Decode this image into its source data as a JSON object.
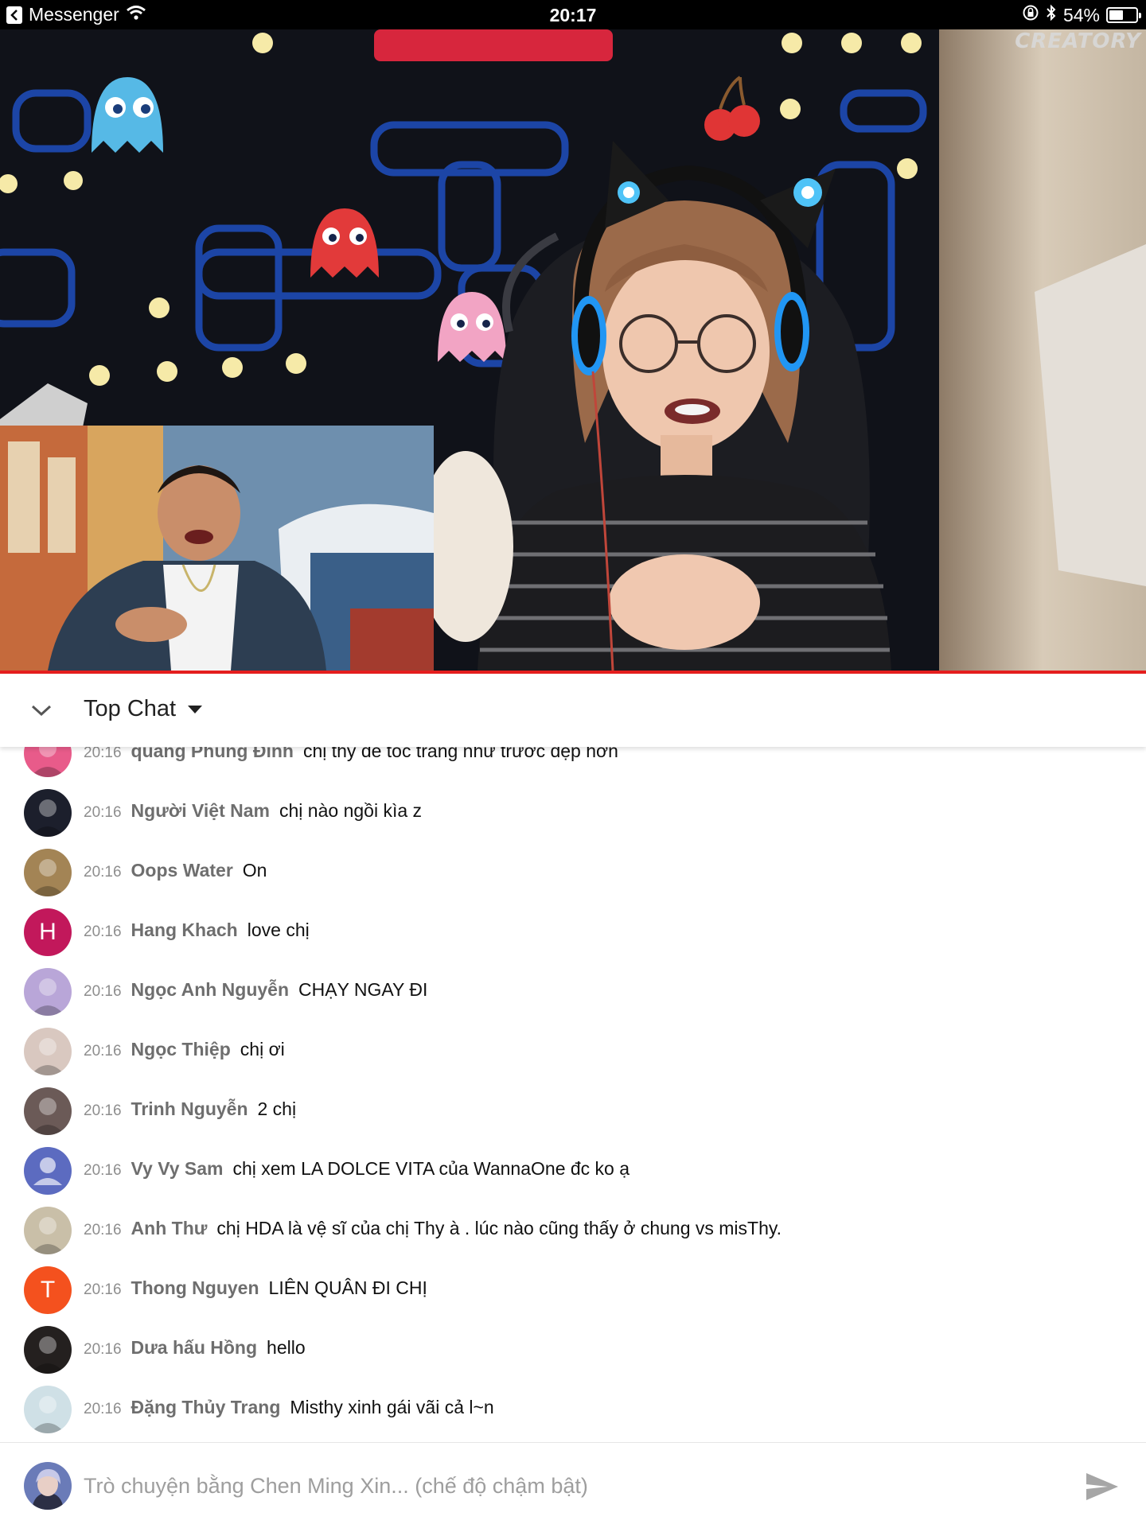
{
  "status_bar": {
    "back_app": "Messenger",
    "time": "20:17",
    "battery": "54%",
    "battery_level": 0.54
  },
  "video": {
    "watermark": "CREATORY",
    "progress": 1.0,
    "progress_color": "#e51e1e"
  },
  "chat_header": {
    "title": "Top Chat"
  },
  "messages": [
    {
      "time": "20:16",
      "author": "quang Phùng Đình",
      "text": "chị thy để tóc trăng như trước đẹp hơn",
      "avatar_color": "#e85b8a",
      "avatar_letter": ""
    },
    {
      "time": "20:16",
      "author": "Người Việt Nam",
      "text": "chị nào ngồi kìa z",
      "avatar_color": "#1c1f2c",
      "avatar_letter": ""
    },
    {
      "time": "20:16",
      "author": "Oops Water",
      "text": "On",
      "avatar_color": "#a38455",
      "avatar_letter": ""
    },
    {
      "time": "20:16",
      "author": "Hang Khach",
      "text": "love chị",
      "avatar_color": "#c2185b",
      "avatar_letter": "H"
    },
    {
      "time": "20:16",
      "author": "Ngọc Anh Nguyễn",
      "text": "CHẠY NGAY ĐI",
      "avatar_color": "#b9a6d8",
      "avatar_letter": ""
    },
    {
      "time": "20:16",
      "author": "Ngọc Thiệp",
      "text": "chị ơi",
      "avatar_color": "#d9c8c0",
      "avatar_letter": ""
    },
    {
      "time": "20:16",
      "author": "Trinh Nguyễn",
      "text": "2 chị",
      "avatar_color": "#6b5a57",
      "avatar_letter": ""
    },
    {
      "time": "20:16",
      "author": "Vy Vy Sam",
      "text": "chị xem LA DOLCE VITA của WannaOne đc ko ạ",
      "avatar_color": "#5c6bc0",
      "avatar_letter": ""
    },
    {
      "time": "20:16",
      "author": "Anh Thư",
      "text": "chị HDA là vệ sĩ của chị Thy à . lúc nào cũng thấy ở chung vs misThy.",
      "avatar_color": "#c9bfa8",
      "avatar_letter": ""
    },
    {
      "time": "20:16",
      "author": "Thong Nguyen",
      "text": "LIÊN QUÂN ĐI CHỊ",
      "avatar_color": "#f4511e",
      "avatar_letter": "T"
    },
    {
      "time": "20:16",
      "author": "Dưa hấu Hồng",
      "text": "hello",
      "avatar_color": "#24201f",
      "avatar_letter": ""
    },
    {
      "time": "20:16",
      "author": "Đặng Thủy Trang",
      "text": "Misthy xinh gái vãi cả l~n",
      "avatar_color": "#cfe0e6",
      "avatar_letter": ""
    }
  ],
  "input": {
    "placeholder": "Trò chuyện bằng Chen Ming Xin... (chế độ chậm bật)",
    "value": ""
  }
}
